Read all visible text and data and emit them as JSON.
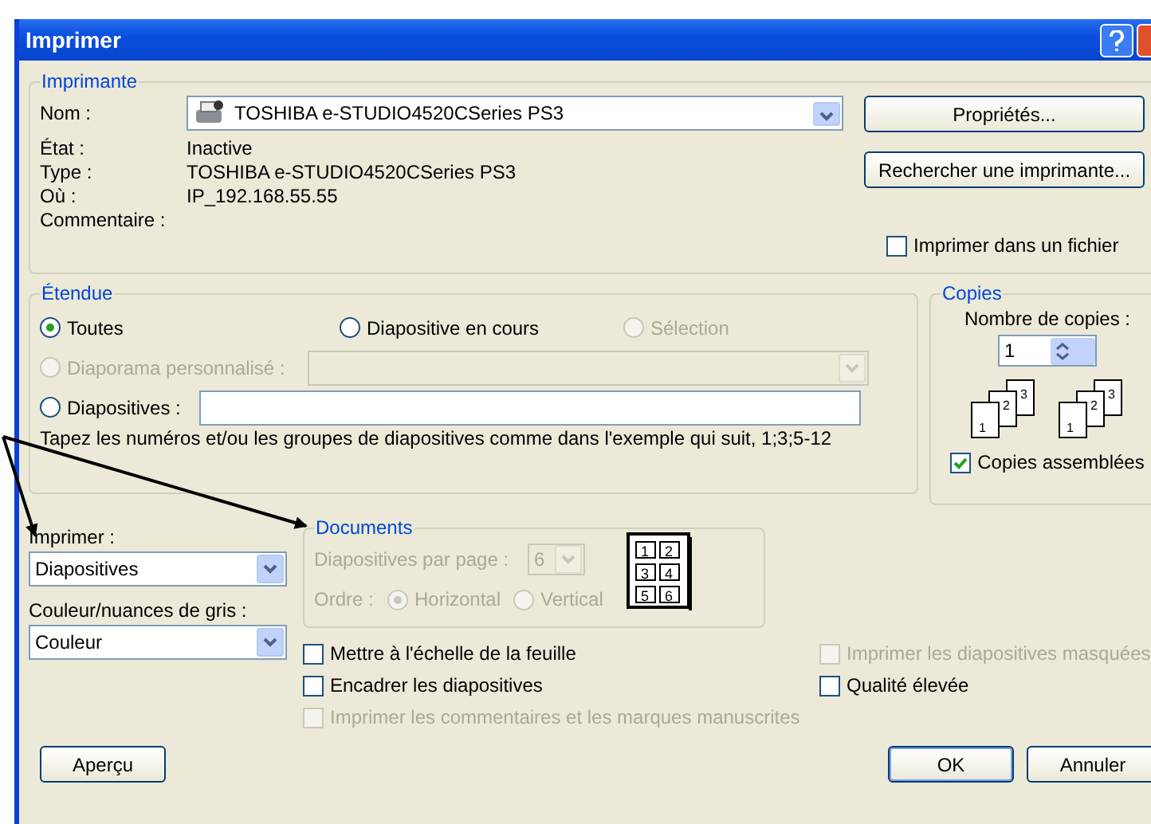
{
  "window": {
    "title": "Imprimer"
  },
  "printer": {
    "group_title": "Imprimante",
    "name_label": "Nom :",
    "name_value": "TOSHIBA e-STUDIO4520CSeries PS3",
    "fields": [
      {
        "label": "État :",
        "value": "Inactive"
      },
      {
        "label": "Type :",
        "value": "TOSHIBA e-STUDIO4520CSeries PS3"
      },
      {
        "label": "Où :",
        "value": "IP_192.168.55.55"
      },
      {
        "label": "Commentaire :"
      }
    ],
    "buttons": [
      "Propriétés...",
      "Rechercher une imprimante..."
    ],
    "print_to_file": {
      "label": "Imprimer dans un fichier",
      "checked": false
    }
  },
  "range": {
    "group_title": "Étendue",
    "options": [
      {
        "label": "Toutes",
        "selected": true,
        "disabled": false
      },
      {
        "label": "Diapositive en cours",
        "selected": false,
        "disabled": false
      },
      {
        "label": "Sélection",
        "selected": false,
        "disabled": true
      }
    ],
    "custom_show": {
      "label": "Diaporama personnalisé :",
      "selected": false,
      "disabled": true
    },
    "slides": {
      "label": "Diapositives :",
      "selected": false,
      "disabled": false
    },
    "hint": "Tapez les numéros et/ou les groupes de diapositives comme dans l'exemple qui suit, 1;3;5-12"
  },
  "copies": {
    "group_title": "Copies",
    "count_label": "Nombre de copies :",
    "count": "1",
    "stacks": [
      [
        "1",
        "2",
        "3"
      ],
      [
        "1",
        "2",
        "3"
      ]
    ],
    "collate": {
      "label": "Copies assemblées",
      "checked": true
    }
  },
  "print_what": {
    "label": "Imprimer :",
    "value": "Diapositives"
  },
  "color": {
    "label": "Couleur/nuances de gris :",
    "value": "Couleur"
  },
  "handouts": {
    "group_title": "Documents",
    "disabled": true,
    "per_page_label": "Diapositives par page :",
    "per_page": "6",
    "order_label": "Ordre :",
    "orders": [
      {
        "label": "Horizontal",
        "selected": true
      },
      {
        "label": "Vertical",
        "selected": false
      }
    ],
    "layout_pages": [
      "1",
      "2",
      "3",
      "4",
      "5",
      "6"
    ]
  },
  "left_options": [
    {
      "label": "Mettre à l'échelle de la feuille",
      "checked": false,
      "disabled": false
    },
    {
      "label": "Encadrer les diapositives",
      "checked": false,
      "disabled": false
    },
    {
      "label": "Imprimer les commentaires et les marques manuscrites",
      "checked": false,
      "disabled": true
    }
  ],
  "right_options": [
    {
      "label": "Imprimer les diapositives masquées",
      "checked": false,
      "disabled": true
    },
    {
      "label": "Qualité élevée",
      "checked": false,
      "disabled": false
    }
  ],
  "buttons": [
    {
      "label": "Aperçu",
      "kind": "preview"
    },
    {
      "label": "OK",
      "kind": "default"
    },
    {
      "label": "Annuler",
      "kind": "cancel"
    }
  ]
}
